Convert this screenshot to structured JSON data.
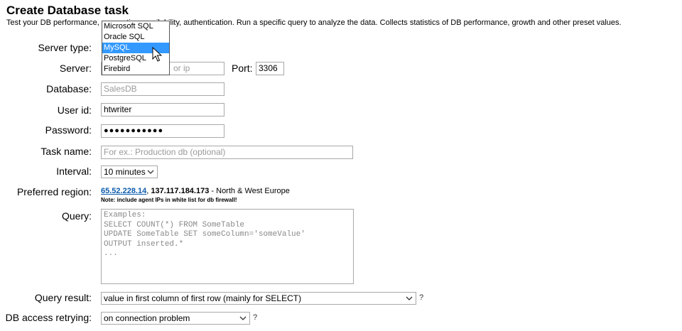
{
  "header": {
    "title": "Create Database task",
    "description": "Test your DB performance, connection, availability, authentication. Run a specific query to analyze the data. Collects statistics of DB performance, growth and other preset values."
  },
  "form": {
    "server_type": {
      "label": "Server type:",
      "options": [
        "Microsoft SQL",
        "Oracle SQL",
        "MySQL",
        "PostgreSQL",
        "Firebird"
      ],
      "highlighted": "MySQL"
    },
    "server": {
      "label": "Server:",
      "placeholder": "or ip"
    },
    "port": {
      "label": "Port:",
      "value": "3306"
    },
    "database": {
      "label": "Database:",
      "placeholder": "SalesDB"
    },
    "user_id": {
      "label": "User id:",
      "value": "htwriter"
    },
    "password": {
      "label": "Password:",
      "value": "●●●●●●●●●●●"
    },
    "task_name": {
      "label": "Task name:",
      "placeholder": "For ex.: Production db (optional)"
    },
    "interval": {
      "label": "Interval:",
      "value": "10 minutes"
    },
    "preferred_region": {
      "label": "Preferred region:",
      "ip1": "65.52.228.14",
      "separator": ",",
      "ip2": "137.117.184.173",
      "region": " - North & West Europe",
      "note": "Note: include agent IPs in white list for db firewall!"
    },
    "query": {
      "label": "Query:",
      "placeholder": "Examples:\nSELECT COUNT(*) FROM SomeTable\nUPDATE SomeTable SET someColumn='someValue'\nOUTPUT inserted.*\n..."
    },
    "query_result": {
      "label": "Query result:",
      "value": "value in first column of first row (mainly for SELECT)",
      "help": "?"
    },
    "db_access_retrying": {
      "label": "DB access retrying:",
      "value": "on connection problem",
      "help": "?"
    }
  }
}
